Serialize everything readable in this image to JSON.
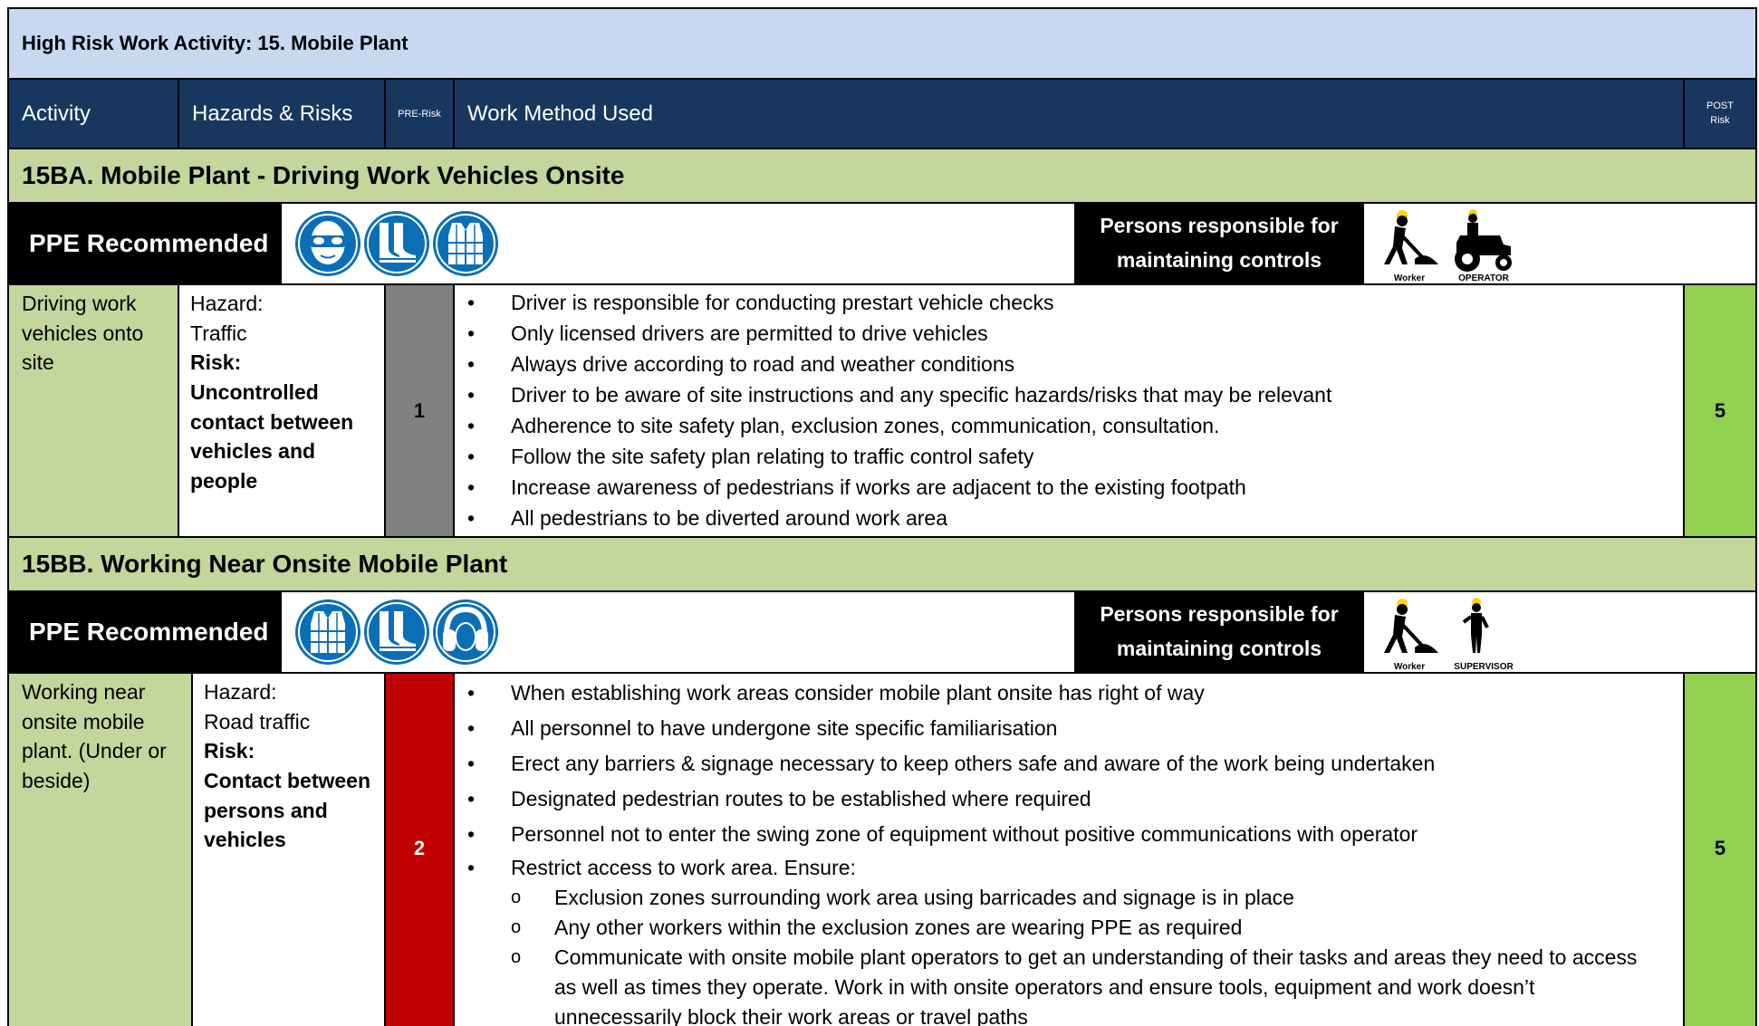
{
  "title": "High Risk Work Activity: 15. Mobile Plant",
  "headers": {
    "activity": "Activity",
    "hazards": "Hazards & Risks",
    "pre_risk": "PRE-Risk",
    "method": "Work Method Used",
    "post_line1": "POST",
    "post_line2": "Risk"
  },
  "colors": {
    "title_bg": "#c6d9f1",
    "header_bg": "#17375e",
    "section_bg": "#c3d69b",
    "post_risk_bg": "#92d050",
    "pre_risk_grey": "#808080",
    "pre_risk_red": "#c00000",
    "ppe_blue": "#0b6fb8"
  },
  "sections": [
    {
      "title": "15BA. Mobile Plant - Driving Work Vehicles Onsite",
      "ppe_label": "PPE Recommended",
      "ppe_icons": [
        "safety-glasses-icon",
        "safety-boots-icon",
        "hi-vis-vest-icon"
      ],
      "responsible_line1": "Persons responsible for",
      "responsible_line2": "maintaining controls",
      "roles": [
        {
          "icon": "worker-icon",
          "label": "Worker"
        },
        {
          "icon": "operator-icon",
          "label": "OPERATOR"
        }
      ],
      "activity": "Driving work vehicles onto site",
      "hazard_label": "Hazard:",
      "hazard": "Traffic",
      "risk_label": "Risk:",
      "risk": "Uncontrolled contact between vehicles and people",
      "pre_risk": "1",
      "post_risk": "5",
      "methods": [
        "Driver is responsible for conducting prestart vehicle checks",
        "Only licensed drivers are permitted to drive vehicles",
        "Always drive according to road and weather conditions",
        "Driver to be aware of site instructions and any specific hazards/risks that may be relevant",
        "Adherence to site safety plan, exclusion zones, communication, consultation.",
        "Follow the site safety plan relating to traffic control safety",
        "Increase awareness of pedestrians if works are adjacent to the existing footpath",
        "All pedestrians to be diverted around work area"
      ]
    },
    {
      "title": "15BB. Working Near Onsite Mobile Plant",
      "ppe_label": "PPE Recommended",
      "ppe_icons": [
        "hi-vis-vest-icon",
        "safety-boots-icon",
        "ear-protection-icon"
      ],
      "responsible_line1": "Persons responsible for",
      "responsible_line2": "maintaining controls",
      "roles": [
        {
          "icon": "worker-icon",
          "label": "Worker"
        },
        {
          "icon": "supervisor-icon",
          "label": "SUPERVISOR"
        }
      ],
      "activity": "Working near onsite mobile plant. (Under or beside)",
      "hazard_label": "Hazard:",
      "hazard": "Road traffic",
      "risk_label": "Risk:",
      "risk": "Contact between persons and vehicles",
      "pre_risk": "2",
      "post_risk": "5",
      "methods": [
        "When establishing work areas consider mobile plant onsite has right of way",
        "All personnel to have undergone site specific familiarisation",
        "Erect any barriers & signage necessary to keep others safe and aware of the work being undertaken",
        "Designated pedestrian routes to be established where required",
        "Personnel not to enter the swing zone of equipment without positive communications with operator",
        "Restrict access to work area. Ensure:"
      ],
      "sub_methods": [
        "Exclusion zones surrounding work area using barricades and signage is in place",
        "Any other workers within the exclusion zones are wearing PPE as required",
        "Communicate with onsite mobile plant operators to get an understanding of their tasks and areas they need to access as well as times they operate.  Work in with onsite operators and ensure tools, equipment and work doesn’t unnecessarily block their work areas or travel paths"
      ]
    }
  ]
}
